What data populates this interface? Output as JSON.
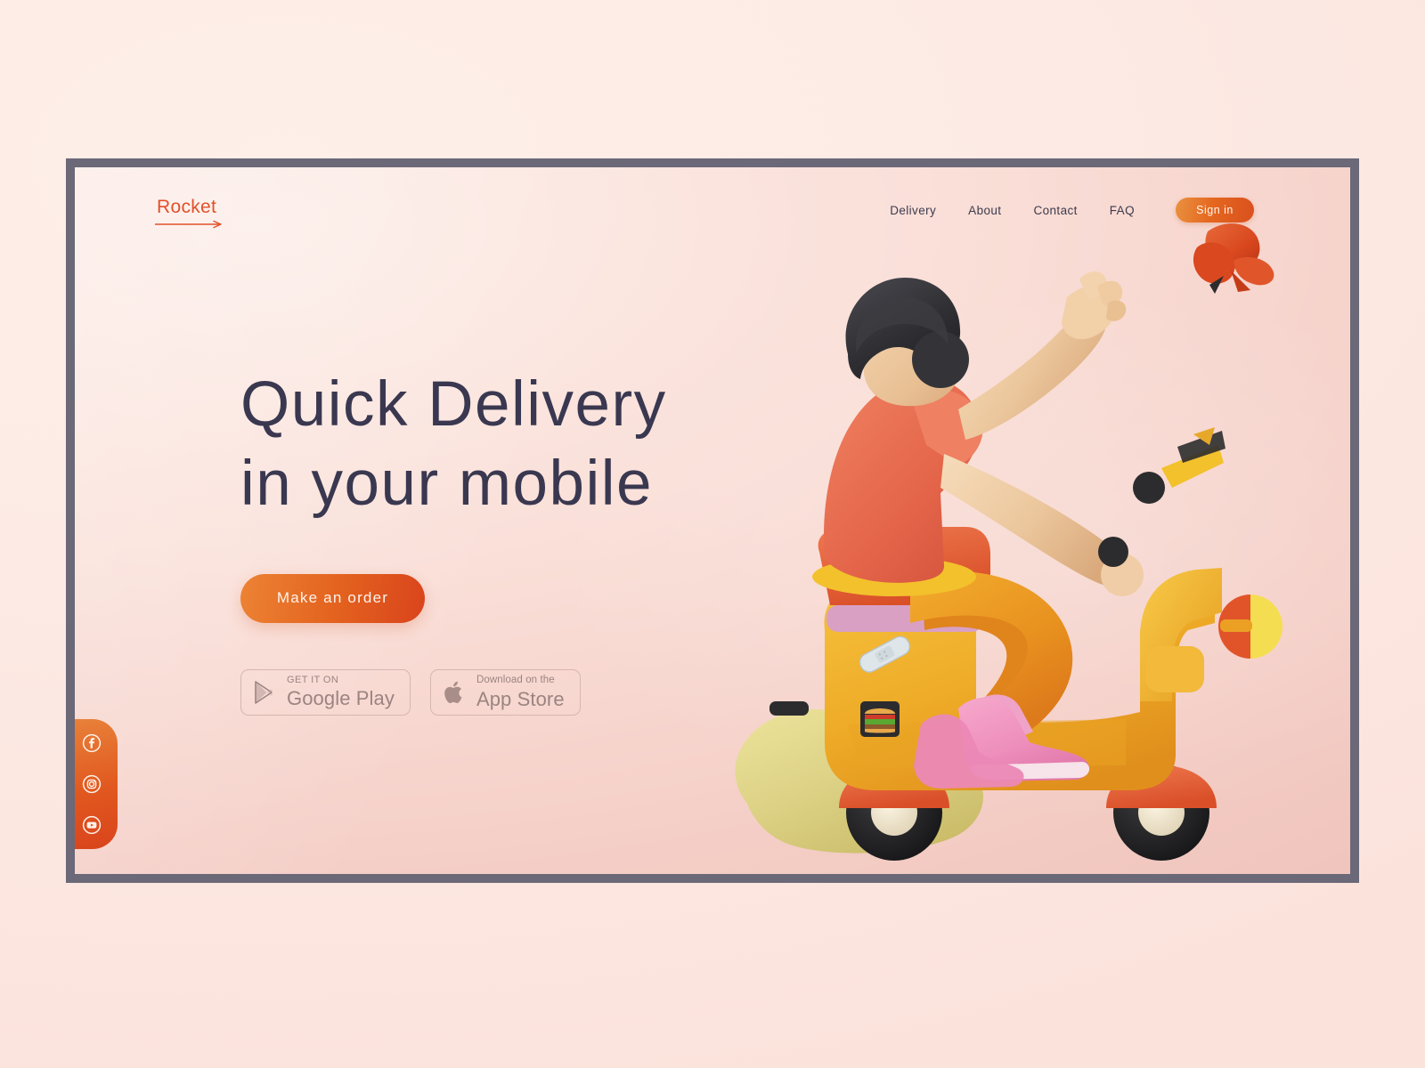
{
  "page": {
    "background_color": "#fdeae4",
    "frame_border_color": "#6b6878",
    "viewport_background": "#f6d3cb"
  },
  "brand": {
    "logo_text": "Rocket",
    "logo_color": "#e2502a",
    "accent_color": "#e4641f",
    "headline_color": "#3a3850"
  },
  "header": {
    "nav_items": [
      {
        "label": "Delivery"
      },
      {
        "label": "About"
      },
      {
        "label": "Contact"
      },
      {
        "label": "FAQ"
      }
    ],
    "signin_label": "Sign in"
  },
  "hero": {
    "headline_line1": "Quick Delivery",
    "headline_line2": "in your mobile",
    "cta_label": "Make an order"
  },
  "store_badges": [
    {
      "icon": "google-play-icon",
      "small_text": "GET IT ON",
      "big_text": "Google Play"
    },
    {
      "icon": "apple-icon",
      "small_text": "Download on the",
      "big_text": "App Store"
    }
  ],
  "social": {
    "items": [
      {
        "icon": "facebook-icon",
        "label": "Facebook"
      },
      {
        "icon": "instagram-icon",
        "label": "Instagram"
      },
      {
        "icon": "youtube-icon",
        "label": "YouTube"
      }
    ],
    "background_color": "#e1581f"
  },
  "illustration": {
    "alt": "3D courier riding a yellow scooter with a butterfly",
    "colors": {
      "scooter_body": "#eeab27",
      "scooter_fender": "#e5623c",
      "shirt": "#e76a4e",
      "pants": "#eb9a24",
      "hair": "#2f2f33",
      "skin": "#edc59c",
      "shoes": "#ef93bd",
      "smoke": "#dfd489",
      "butterfly": "#d9481f",
      "headlight_red": "#e1542a",
      "headlight_yellow": "#f5dd52",
      "seat_strap": "#d9a0c4"
    },
    "stickers": [
      "bandage-sticker",
      "burger-sticker"
    ]
  }
}
